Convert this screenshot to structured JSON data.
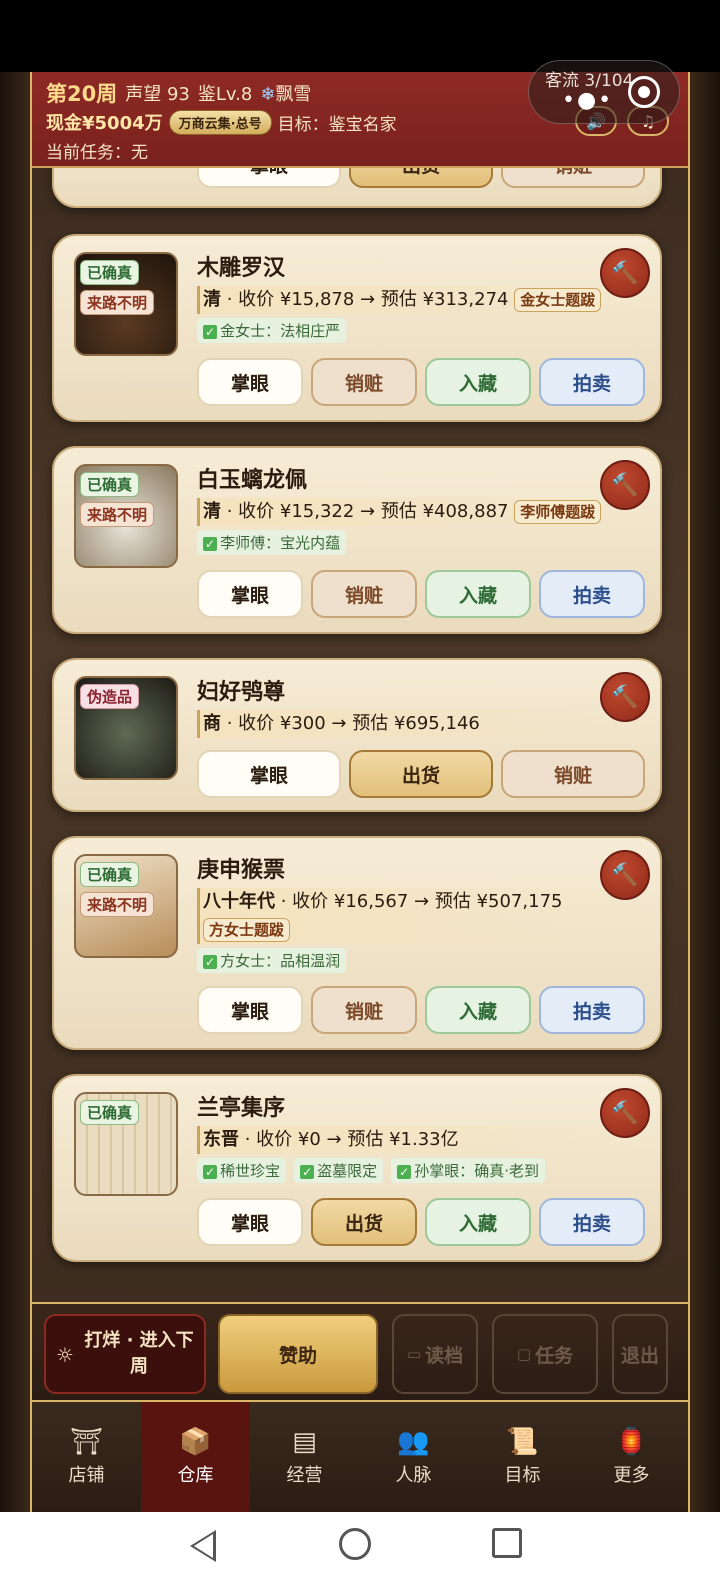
{
  "header": {
    "week": "第20周",
    "reputation": "声望 93",
    "appraise_level": "鉴Lv.8",
    "weather": "飘雪",
    "cash": "现金¥5004万",
    "shop_badge": "万商云集·总号",
    "goal": "目标：鉴宝名家",
    "task": "当前任务：无",
    "sound_icon": "speaker-icon",
    "music_icon": "music-icon"
  },
  "overlay": {
    "visitors": "客流 3/104"
  },
  "top_partial": {
    "btn1": "掌眼",
    "btn2": "出货",
    "btn3": "销赃"
  },
  "items": [
    {
      "name": "木雕罗汉",
      "tags": [
        "已确真",
        "来路不明"
      ],
      "dynasty": "清",
      "buy": "收价 ¥15,878",
      "est": "预估 ¥313,274",
      "seal": "金女士题跋",
      "chips": [
        "金女士：法相庄严"
      ],
      "buttons": [
        "掌眼",
        "销赃",
        "入藏",
        "拍卖"
      ]
    },
    {
      "name": "白玉螭龙佩",
      "tags": [
        "已确真",
        "来路不明"
      ],
      "dynasty": "清",
      "buy": "收价 ¥15,322",
      "est": "预估 ¥408,887",
      "seal": "李师傅题跋",
      "chips": [
        "李师傅：宝光内蕴"
      ],
      "buttons": [
        "掌眼",
        "销赃",
        "入藏",
        "拍卖"
      ]
    },
    {
      "name": "妇好鸮尊",
      "tags": [
        "伪造品"
      ],
      "dynasty": "商",
      "buy": "收价 ¥300",
      "est": "预估 ¥695,146",
      "buttons": [
        "掌眼",
        "出货",
        "销赃"
      ]
    },
    {
      "name": "庚申猴票",
      "tags": [
        "已确真",
        "来路不明"
      ],
      "dynasty": "八十年代",
      "buy": "收价 ¥16,567",
      "est": "预估 ¥507,175",
      "seal": "方女士题跋",
      "chips": [
        "方女士：品相温润"
      ],
      "buttons": [
        "掌眼",
        "销赃",
        "入藏",
        "拍卖"
      ]
    },
    {
      "name": "兰亭集序",
      "tags": [
        "已确真"
      ],
      "dynasty": "东晋",
      "buy": "收价 ¥0",
      "est": "预估 ¥1.33亿",
      "chips": [
        "稀世珍宝",
        "盗墓限定",
        "孙掌眼：确真·老到"
      ],
      "buttons": [
        "掌眼",
        "出货",
        "入藏",
        "拍卖"
      ]
    }
  ],
  "bottom": {
    "close_shop": "打烊 · 进入下周",
    "sponsor": "赞助",
    "load": "读档",
    "tasks": "任务",
    "exit": "退出"
  },
  "tabs": [
    {
      "label": "店铺",
      "icon": "shop-icon"
    },
    {
      "label": "仓库",
      "icon": "warehouse-icon"
    },
    {
      "label": "经营",
      "icon": "ledger-icon"
    },
    {
      "label": "人脉",
      "icon": "people-icon"
    },
    {
      "label": "目标",
      "icon": "scroll-icon"
    },
    {
      "label": "更多",
      "icon": "more-icon"
    }
  ]
}
